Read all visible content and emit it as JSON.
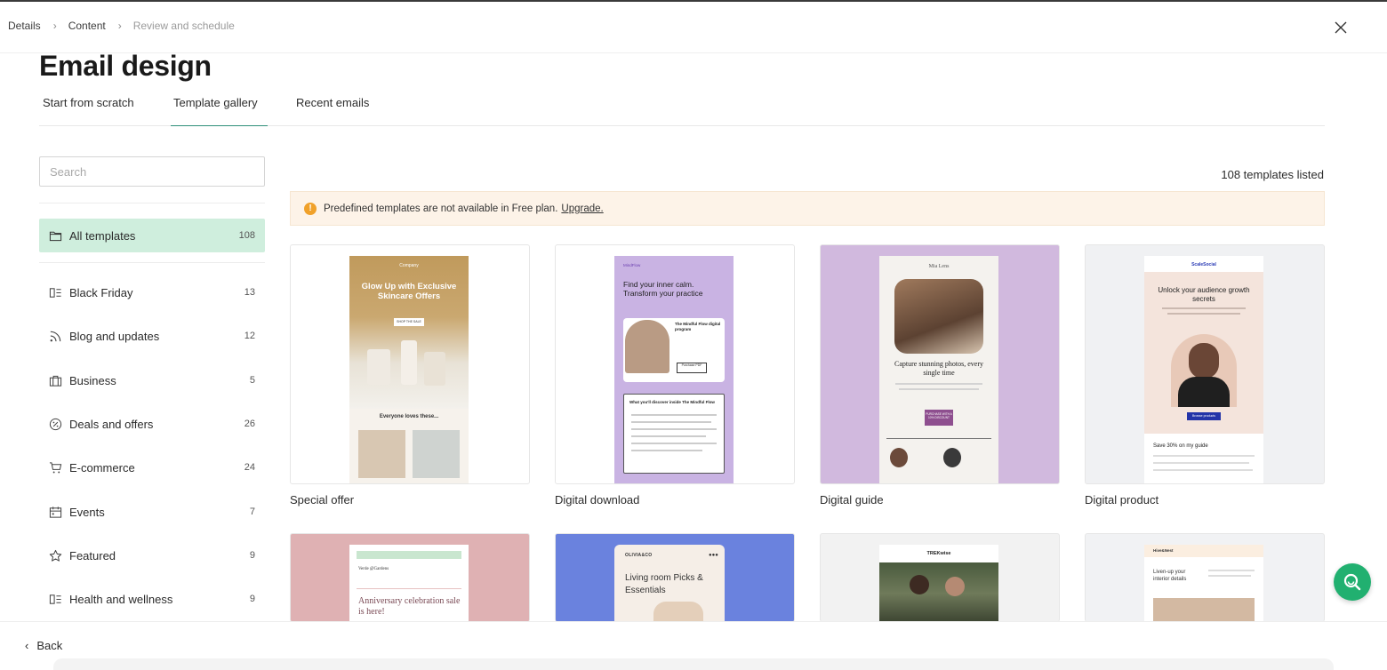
{
  "breadcrumb": [
    "Details",
    "Content",
    "Review and schedule"
  ],
  "page_title": "Email design",
  "tabs": [
    "Start from scratch",
    "Template gallery",
    "Recent emails"
  ],
  "active_tab": "Template gallery",
  "search": {
    "placeholder": "Search",
    "value": ""
  },
  "categories": [
    {
      "label": "All templates",
      "count": "108",
      "icon": "folder-icon"
    },
    {
      "label": "Black Friday",
      "count": "13",
      "icon": "layout-icon"
    },
    {
      "label": "Blog and updates",
      "count": "12",
      "icon": "rss-icon"
    },
    {
      "label": "Business",
      "count": "5",
      "icon": "briefcase-icon"
    },
    {
      "label": "Deals and offers",
      "count": "26",
      "icon": "percent-badge-icon"
    },
    {
      "label": "E-commerce",
      "count": "24",
      "icon": "cart-icon"
    },
    {
      "label": "Events",
      "count": "7",
      "icon": "calendar-icon"
    },
    {
      "label": "Featured",
      "count": "9",
      "icon": "star-icon"
    },
    {
      "label": "Health and wellness",
      "count": "9",
      "icon": "layout-icon"
    }
  ],
  "templates_count": "108 templates listed",
  "notice": {
    "text": "Predefined templates are not available in Free plan.",
    "link": "Upgrade."
  },
  "templates": [
    {
      "label": "Special offer"
    },
    {
      "label": "Digital download"
    },
    {
      "label": "Digital guide"
    },
    {
      "label": "Digital product"
    }
  ],
  "previews": {
    "special_offer": {
      "brand": "Company",
      "headline": "Glow Up with Exclusive Skincare Offers",
      "cta": "SHOP THE SALE",
      "subhead": "Everyone loves these..."
    },
    "digital_download": {
      "brand": "MindFlow",
      "headline": "Find your inner calm. Transform your practice",
      "product": "The Mindful Flow digital program",
      "cta": "Purchase PDF",
      "list_title": "What you'll discover inside The Mindful Flow"
    },
    "digital_guide": {
      "brand": "Mia Lens",
      "headline": "Capture stunning photos, every single time",
      "cta": "PURCHASE WITH A 10% DISCOUNT"
    },
    "digital_product": {
      "brand": "ScaleSocial",
      "headline": "Unlock your audience growth secrets",
      "cta": "Browse products",
      "subhead": "Save 30% on my guide"
    },
    "anniversary": {
      "brand": "Verde @Gardens",
      "headline": "Anniversary celebration sale is here!"
    },
    "living_room": {
      "brand": "OLIVIA&CO",
      "headline": "Living room Picks & Essentials"
    },
    "trek": {
      "brand": "TREKwise"
    },
    "interior": {
      "brand": "Hive&Nest",
      "headline": "Liven-up your interior details"
    }
  },
  "back_label": "Back",
  "colors": {
    "active_category_bg": "#cfeedd",
    "accent": "#2f8f7a",
    "fab": "#21b070",
    "notice_bg": "#fdf3e8"
  }
}
